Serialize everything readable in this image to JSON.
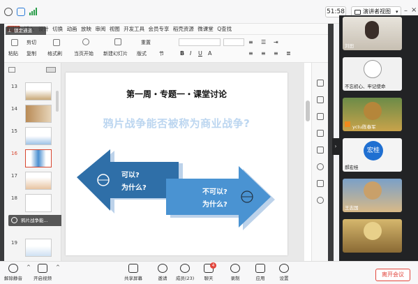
{
  "topbar": {
    "time": "51:58",
    "view_label": "演讲者视图"
  },
  "wps": {
    "minimize_tooltip": "锁定通道",
    "menu": [
      "开始",
      "插入",
      "设计",
      "切换",
      "动画",
      "放映",
      "审阅",
      "视图",
      "开发工具",
      "会员专享",
      "稻壳资源",
      "微课堂",
      "Q查找"
    ],
    "ribbon": {
      "cut": "剪切",
      "paste": "粘贴",
      "copy": "复制",
      "format_painter": "格式刷",
      "play_from_current": "当页开始",
      "new_slide": "新建幻灯片",
      "layout": "版式",
      "section": "节",
      "reset": "重置"
    },
    "thumb_numbers": [
      "13",
      "14",
      "15",
      "16",
      "17",
      "18",
      "19"
    ],
    "selected_thumb": "16",
    "thumb_tooltip": "鸦片战争能...",
    "slide": {
      "title": "第一周・专题一・课堂讨论",
      "question": "鸦片战争能否被称为商业战争?",
      "left_arrow_text": "可以?\n为什么?",
      "left_line1": "可以?",
      "left_line2": "为什么?",
      "right_line1": "不可以?",
      "right_line2": "为什么?"
    }
  },
  "participants": [
    {
      "name": "刘田"
    },
    {
      "name": "不忘初心、牢记使命"
    },
    {
      "name": "yctu陈春军"
    },
    {
      "name": "郝宏桂",
      "avatar_text": "宏桂"
    },
    {
      "name": "王志国"
    },
    {
      "name": ""
    }
  ],
  "bottombar": {
    "items": [
      "解除静音",
      "开启视频",
      "共享屏幕",
      "邀请",
      "成员(23)",
      "聊天",
      "录制",
      "应用",
      "设置"
    ],
    "chat_badge": "4",
    "leave": "离开会议"
  },
  "colors": {
    "accent": "#d7462f",
    "arrow_blue": "#2f6fa8",
    "arrow_light": "#4a93d2",
    "leave_red": "#e2453c"
  }
}
